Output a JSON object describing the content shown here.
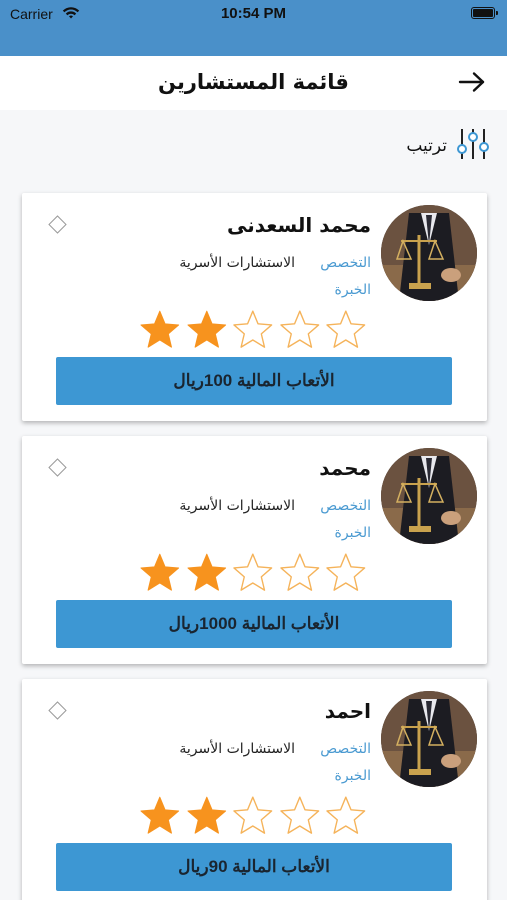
{
  "status_bar": {
    "carrier": "Carrier",
    "time": "10:54 PM",
    "wifi_icon": "wifi-icon",
    "battery_icon": "battery-icon"
  },
  "header": {
    "title": "قائمة المستشارين",
    "back_icon": "arrow-right-icon",
    "color": "#4a90c9"
  },
  "sort": {
    "label": "ترتيب",
    "icon": "sliders-icon"
  },
  "consultants": [
    {
      "name": "محمد السعدنى",
      "specialty_label": "التخصص",
      "specialty_value": "الاستشارات الأسرية",
      "experience_label": "الخبرة",
      "rating": 2,
      "rating_max": 5,
      "fee_label": "الأتعاب المالية 100ريال"
    },
    {
      "name": "محمد",
      "specialty_label": "التخصص",
      "specialty_value": "الاستشارات الأسرية",
      "experience_label": "الخبرة",
      "rating": 2,
      "rating_max": 5,
      "fee_label": "الأتعاب المالية 1000ريال"
    },
    {
      "name": "احمد",
      "specialty_label": "التخصص",
      "specialty_value": "الاستشارات الأسرية",
      "experience_label": "الخبرة",
      "rating": 2,
      "rating_max": 5,
      "fee_label": "الأتعاب المالية 90ريال"
    }
  ],
  "colors": {
    "accent": "#3d97d3",
    "label_blue": "#4a9ad1",
    "star_filled": "#f7931e",
    "star_empty": "#f5b35a"
  }
}
